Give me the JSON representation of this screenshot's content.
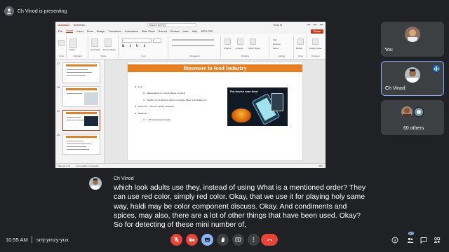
{
  "presenter": {
    "label": "Ch Vinod is presenting"
  },
  "app": {
    "brand": "AutoSave",
    "file_name": "BIOSENS...",
    "search_placeholder": "Search (Alt+Q)",
    "user": "Vinod M",
    "menu": [
      "File",
      "Home",
      "Insert",
      "Draw",
      "Design",
      "Transitions",
      "Animations",
      "Slide Show",
      "Record",
      "Review",
      "View",
      "Help",
      "WPS PDF"
    ],
    "active_menu": "Home",
    "share_label": "Share",
    "ribbon_groups": [
      "Undo",
      "Clipboard",
      "Slides",
      "Font",
      "Paragraph",
      "Drawing",
      "Editing",
      "Voice",
      "Designer"
    ],
    "ribbon_buttons": [
      "Paste",
      "New Slide",
      "Reuse Slides",
      "Shapes",
      "Arrange",
      "Quick Styles",
      "Find",
      "Replace",
      "Select",
      "Dictate",
      "Design Ideas"
    ],
    "status": {
      "slide_count": "Slide 19 of 27",
      "accessibility": "Accessibility: Investigate",
      "zoom": "48%"
    }
  },
  "thumbnails": [
    {
      "num": "17"
    },
    {
      "num": "18"
    },
    {
      "num": "19",
      "selected": true
    },
    {
      "num": "20"
    }
  ],
  "slide": {
    "title": "Biosenser in food Industry",
    "photo_caption": "Put device near food",
    "bullets": [
      {
        "text": "Uses",
        "level": 1
      },
      {
        "text": "Measurement of carbohydrates, alcohols",
        "level": 2
      },
      {
        "text": "Sterility, food safety in meats, beverages (Beer, soft drinks) etc.",
        "level": 2
      },
      {
        "text": "Objective – Used in quality assurance",
        "level": 1
      },
      {
        "text": "Methods",
        "level": 1
      },
      {
        "text": "1. Flow injection system",
        "level": 2
      }
    ]
  },
  "participants": [
    {
      "name": "You"
    },
    {
      "name": "Ch Vinod",
      "active": true
    },
    {
      "name": "60 others"
    }
  ],
  "caption": {
    "speaker": "Ch Vinod",
    "text": "which look adults use they, instead of using What is a mentioned order? They can use red color, simply red color. Okay, that we use it for playing holy same way, haldi may be color component discuss. Okay. And condiments and spices, may also, there are a lot of other things that have been used. Okay? So for detecting of these mini number of,"
  },
  "meeting": {
    "time": "10:55 AM",
    "code": "smj-ymzy-yux",
    "participant_badge": "63"
  },
  "colors": {
    "accent": "#8ab4f8",
    "danger": "#ea4335",
    "slide_title": "#e67e22"
  },
  "controls": [
    "mic-off",
    "camera-off",
    "captions",
    "raise-hand",
    "present",
    "more-options",
    "leave-call"
  ],
  "right_icons": [
    "info-icon",
    "people-icon",
    "chat-icon",
    "activities-icon"
  ]
}
